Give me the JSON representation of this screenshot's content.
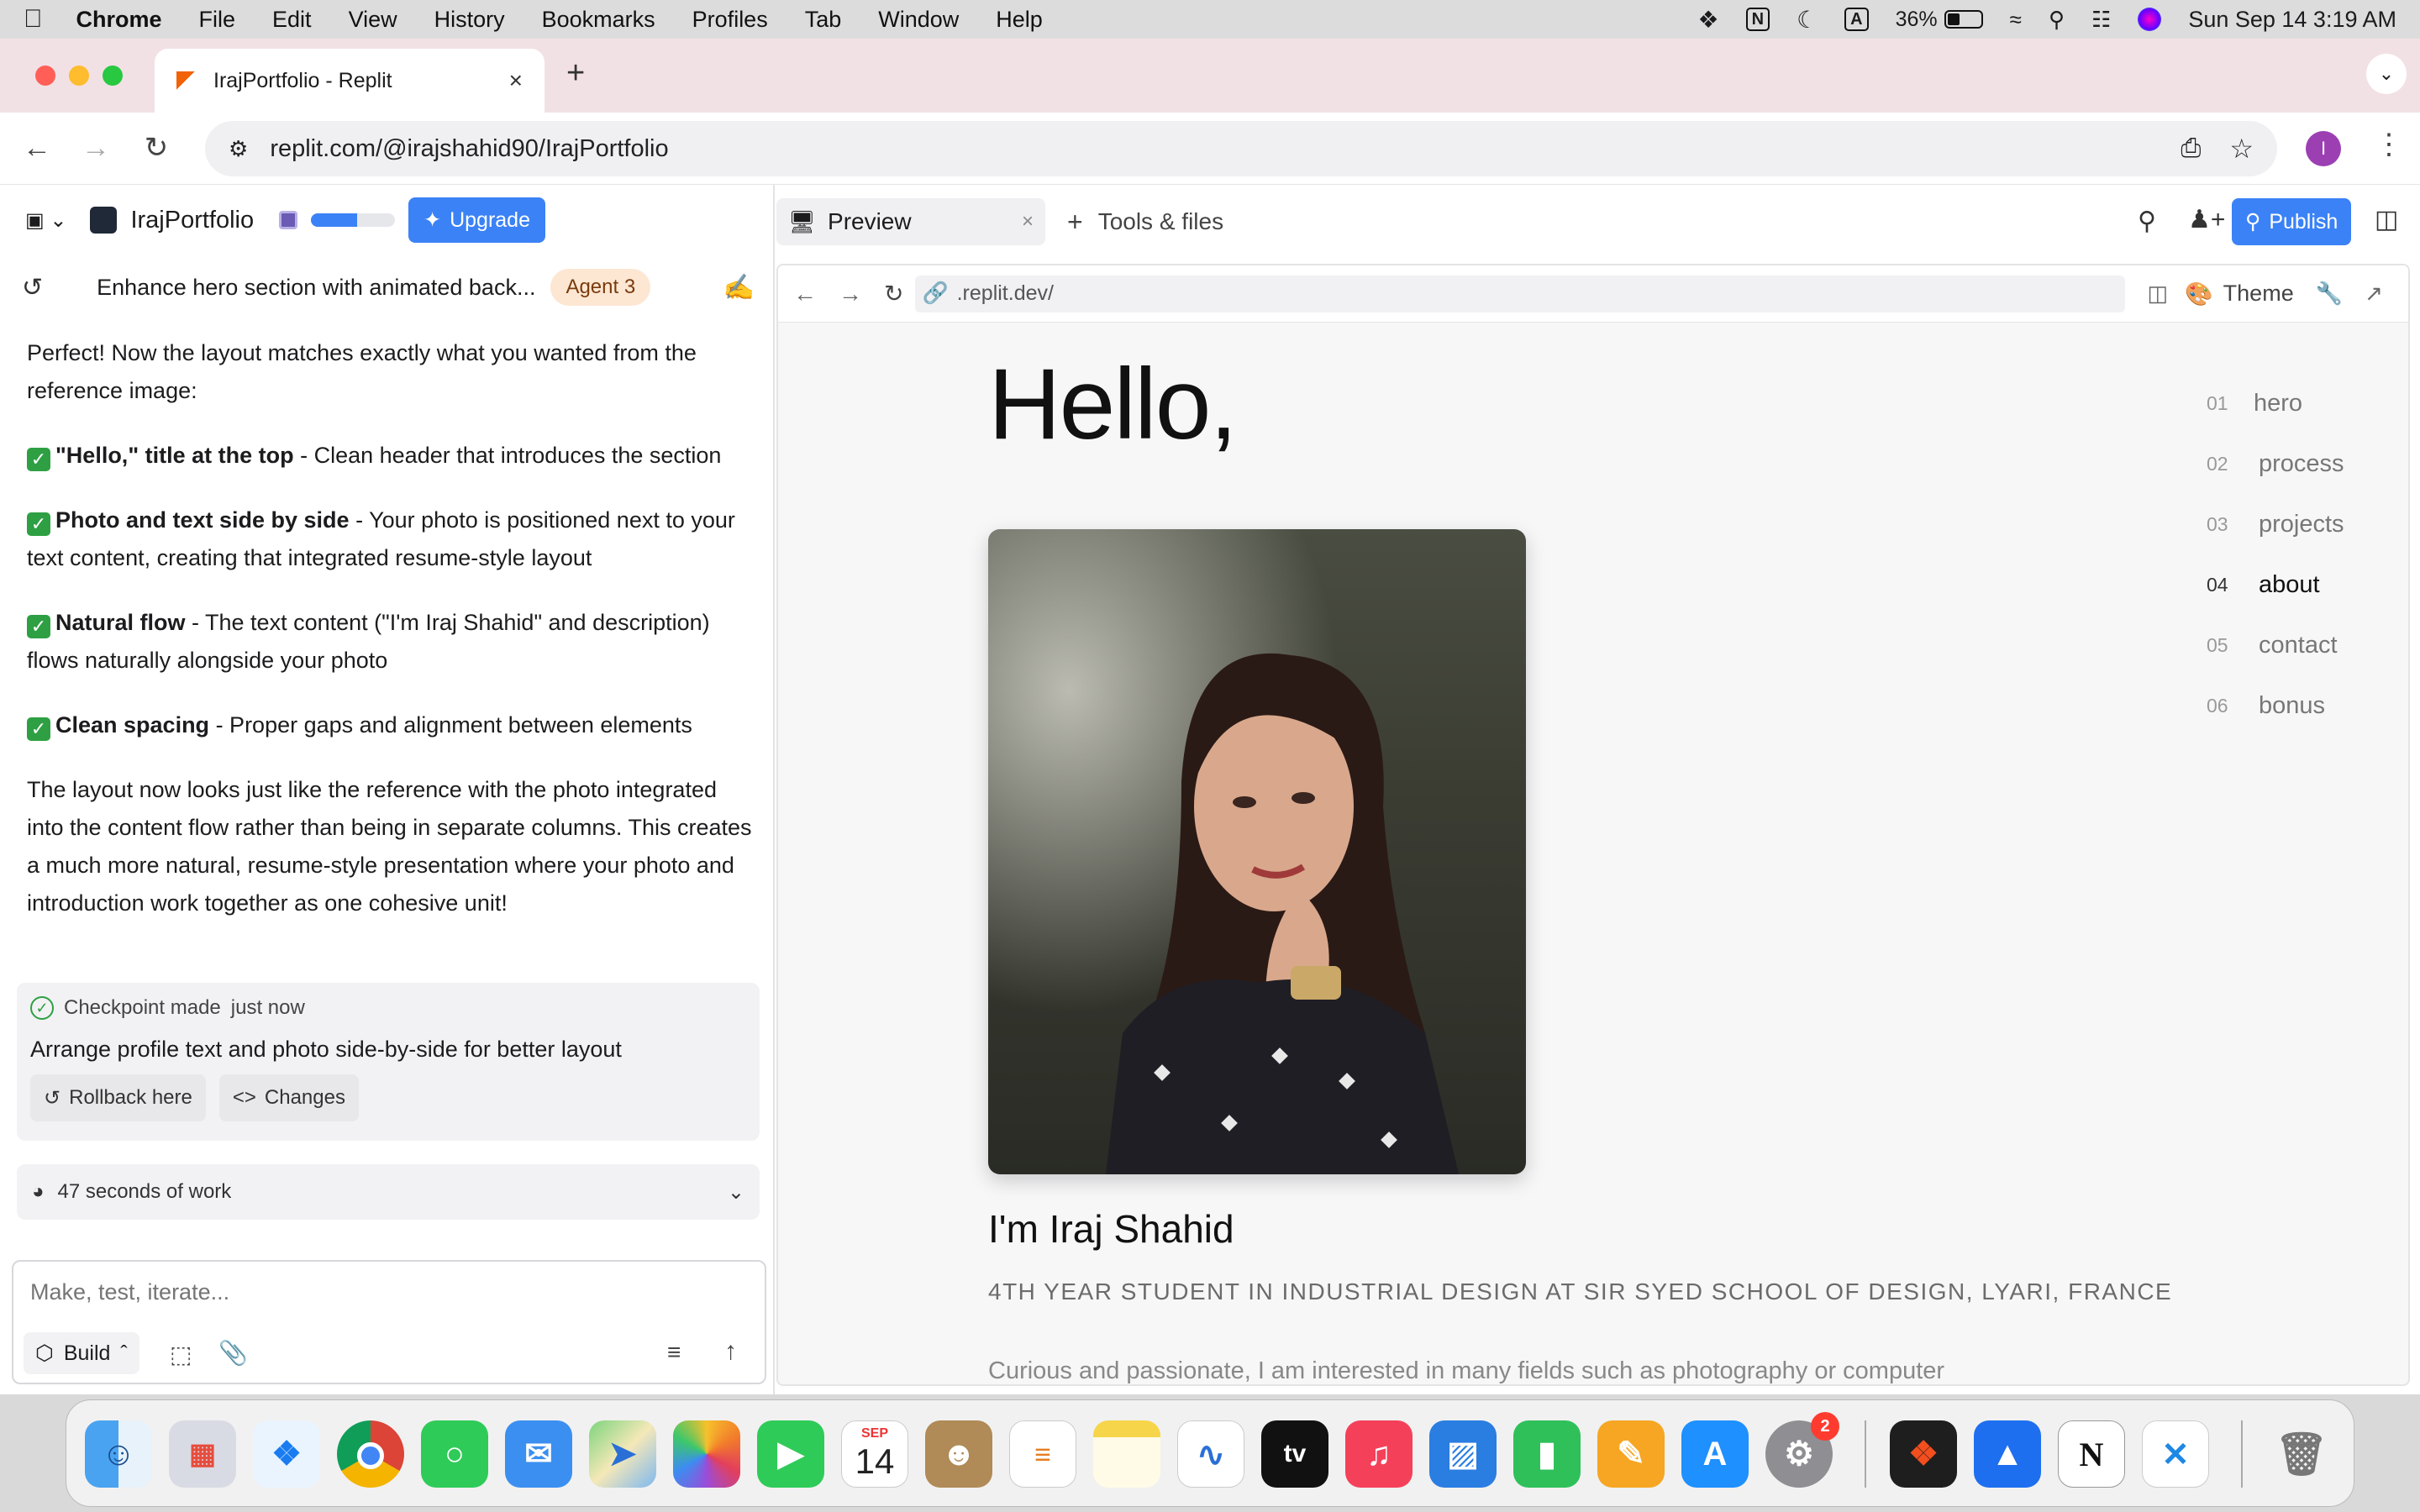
{
  "menubar": {
    "app": "Chrome",
    "items": [
      "File",
      "Edit",
      "View",
      "History",
      "Bookmarks",
      "Profiles",
      "Tab",
      "Window",
      "Help"
    ],
    "battery": "36%",
    "datetime": "Sun Sep 14  3:19 AM"
  },
  "browser": {
    "tab_title": "IrajPortfolio - Replit",
    "url": "replit.com/@irajshahid90/IrajPortfolio",
    "profile_initial": "I"
  },
  "replit": {
    "project_name": "IrajPortfolio",
    "upgrade_label": "Upgrade",
    "thread_title": "Enhance hero section with animated back...",
    "agent_badge": "Agent 3",
    "preview_tab": "Preview",
    "tools_tab": "Tools & files",
    "publish_label": "Publish",
    "preview_url": ".replit.dev/",
    "theme_label": "Theme"
  },
  "chat": {
    "intro": "Perfect! Now the layout matches exactly what you wanted from the reference image:",
    "points": [
      {
        "bold": "\"Hello,\" title at the top",
        "text": " - Clean header that introduces the section"
      },
      {
        "bold": "Photo and text side by side",
        "text": " - Your photo is positioned next to your text content, creating that integrated resume-style layout"
      },
      {
        "bold": "Natural flow",
        "text": " - The text content (\"I'm Iraj Shahid\" and description) flows naturally alongside your photo"
      },
      {
        "bold": "Clean spacing",
        "text": " - Proper gaps and alignment between elements"
      }
    ],
    "summary": "The layout now looks just like the reference with the photo integrated into the content flow rather than being in separate columns. This creates a much more natural, resume-style presentation where your photo and introduction work together as one cohesive unit!",
    "checkpoint_label": "Checkpoint made",
    "checkpoint_time": "just now",
    "checkpoint_desc": "Arrange profile text and photo side-by-side for better layout",
    "rollback_label": "Rollback here",
    "changes_label": "Changes",
    "work_time": "47 seconds of work",
    "input_placeholder": "Make, test, iterate...",
    "build_label": "Build"
  },
  "site": {
    "greeting": "Hello,",
    "name": "I'm Iraj Shahid",
    "subtitle": "4TH YEAR STUDENT IN INDUSTRIAL DESIGN AT SIR SYED SCHOOL OF DESIGN, LYARI, FRANCE",
    "body_partial": "Curious and passionate, I am interested in many fields such as photography or computer",
    "nav": [
      {
        "num": "01",
        "label": "hero"
      },
      {
        "num": "02",
        "label": "process"
      },
      {
        "num": "03",
        "label": "projects"
      },
      {
        "num": "04",
        "label": "about"
      },
      {
        "num": "05",
        "label": "contact"
      },
      {
        "num": "06",
        "label": "bonus"
      }
    ]
  },
  "dock": {
    "calendar_month": "SEP",
    "calendar_day": "14",
    "settings_badge": "2"
  }
}
